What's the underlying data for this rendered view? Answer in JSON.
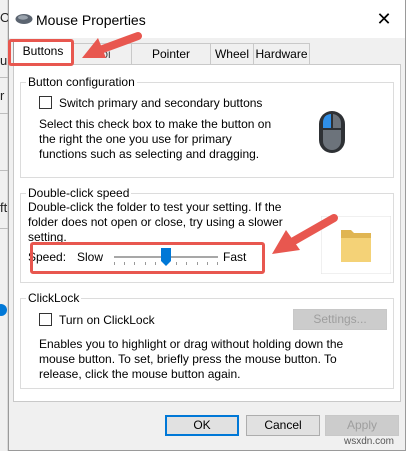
{
  "background": {
    "glyphs": [
      "O",
      "u",
      "r",
      "ft"
    ]
  },
  "window": {
    "title": "Mouse Properties",
    "close_glyph": "✕"
  },
  "tabs": [
    {
      "label": "Buttons",
      "active": true
    },
    {
      "label": "Poi",
      "active": false
    },
    {
      "label": "Pointer Options",
      "active": false
    },
    {
      "label": "Wheel",
      "active": false
    },
    {
      "label": "Hardware",
      "active": false
    }
  ],
  "button_configuration": {
    "legend": "Button configuration",
    "checkbox_label": "Switch primary and secondary buttons",
    "checked": false,
    "description": "Select this check box to make the button on the right the one you use for primary functions such as selecting and dragging."
  },
  "double_click": {
    "legend": "Double-click speed",
    "description": "Double-click the folder to test your setting. If the folder does not open or close, try using a slower setting.",
    "speed_label": "Speed:",
    "slow_label": "Slow",
    "fast_label": "Fast",
    "speed_value": 0.5
  },
  "clicklock": {
    "legend": "ClickLock",
    "checkbox_label": "Turn on ClickLock",
    "checked": false,
    "settings_label": "Settings...",
    "description": "Enables you to highlight or drag without holding down the mouse button. To set, briefly press the mouse button. To release, click the mouse button again."
  },
  "footer": {
    "ok_label": "OK",
    "cancel_label": "Cancel",
    "apply_label": "Apply"
  },
  "colors": {
    "highlight": "#e8574f",
    "accent": "#0078d7"
  },
  "watermark": "wsxdn.com"
}
